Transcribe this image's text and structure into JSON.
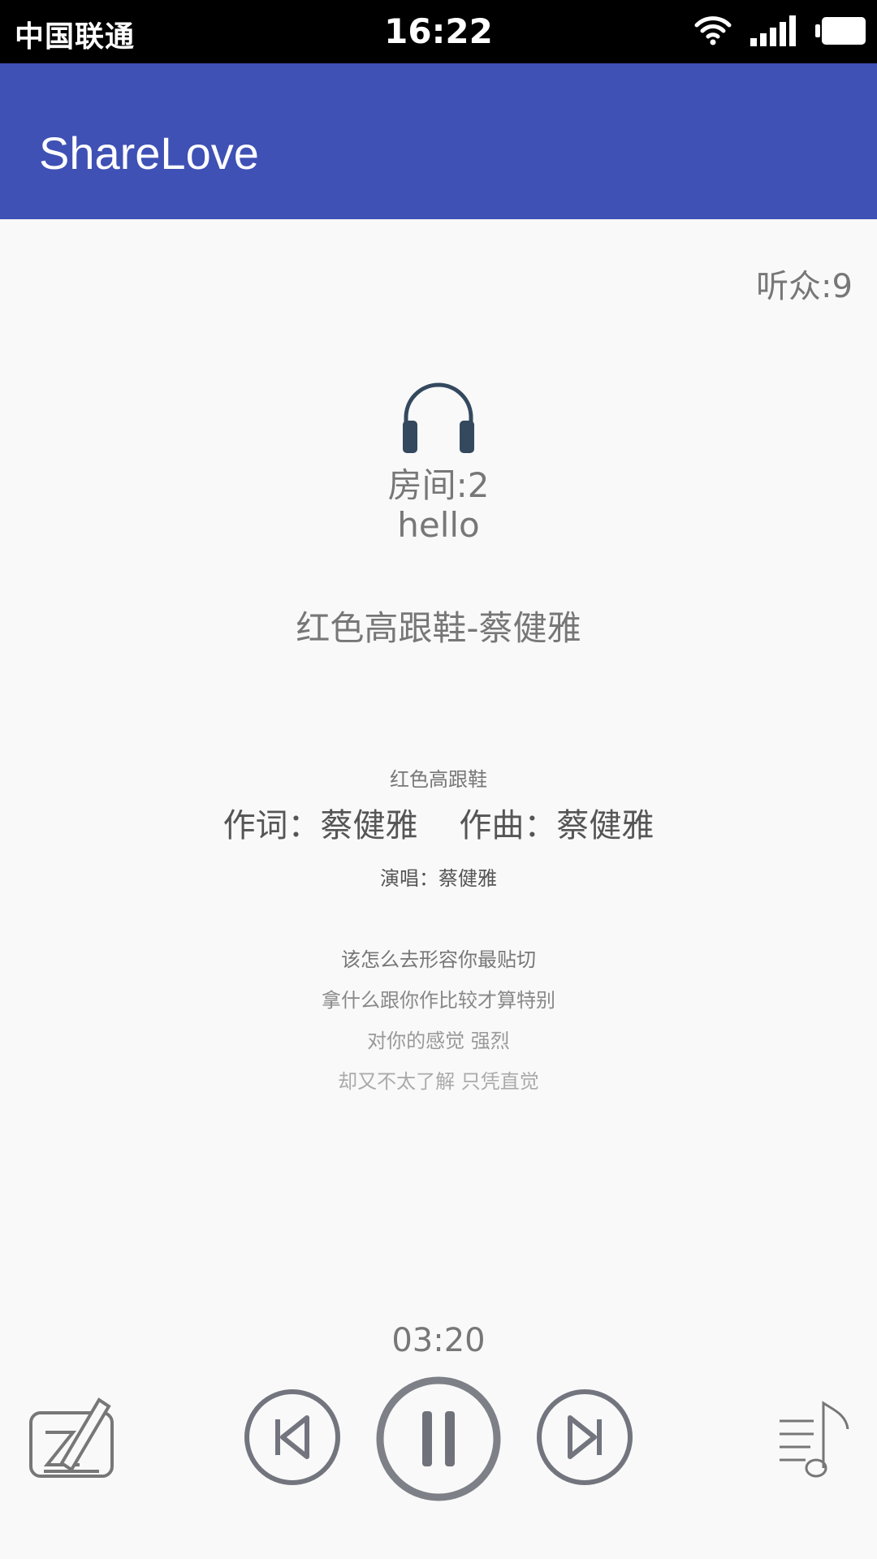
{
  "status_bar": {
    "carrier": "中国联通",
    "time": "16:22",
    "icons": [
      "wifi-icon",
      "signal-icon",
      "battery-icon"
    ]
  },
  "app_bar": {
    "title": "ShareLove",
    "color": "#3f51b5"
  },
  "room": {
    "listeners": "听众:9",
    "icon": "headphones-icon",
    "room_label": "房间:2",
    "room_name": "hello"
  },
  "song": {
    "title": "红色高跟鞋-蔡健雅"
  },
  "lyrics": {
    "header": "红色高跟鞋",
    "current": "作词：蔡健雅    作曲：蔡健雅",
    "performer": "演唱：蔡健雅",
    "lines": [
      "该怎么去形容你最贴切",
      "拿什么跟你作比较才算特别",
      "对你的感觉 强烈",
      "却又不太了解 只凭直觉"
    ]
  },
  "player": {
    "elapsed": "03:20",
    "controls": [
      "edit-icon",
      "previous-icon",
      "pause-icon",
      "next-icon",
      "playlist-icon"
    ]
  }
}
